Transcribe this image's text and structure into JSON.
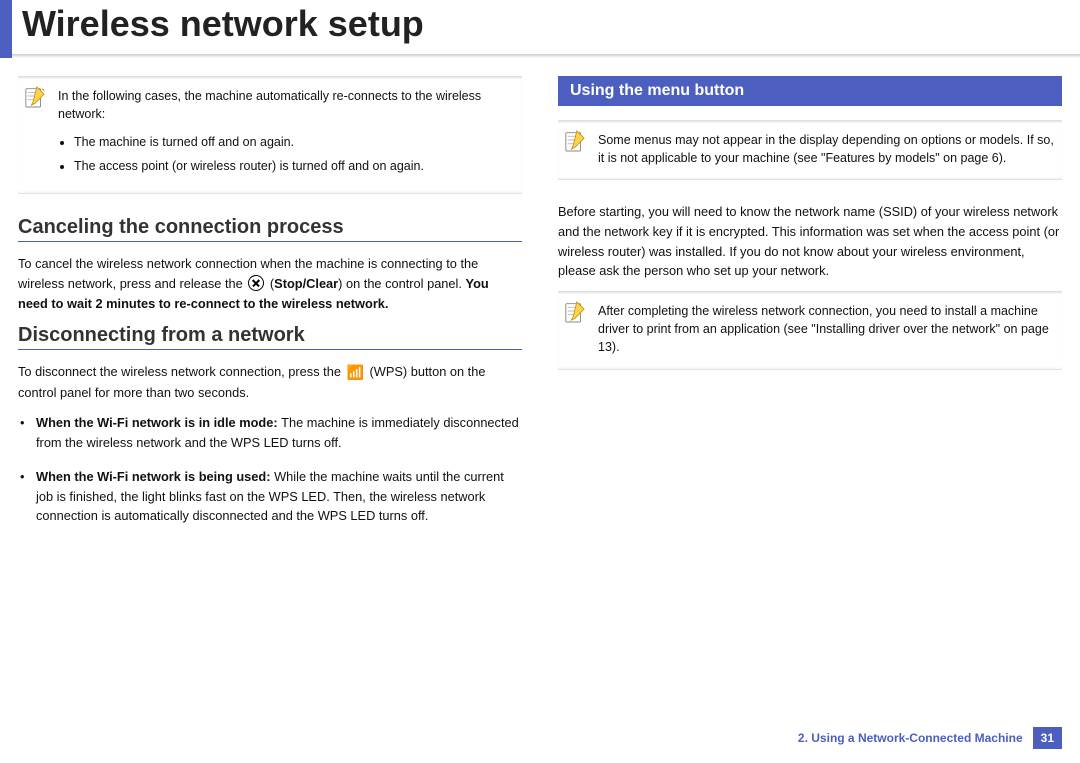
{
  "title": "Wireless network setup",
  "left": {
    "note": {
      "intro": "In the following cases, the machine automatically re-connects to the wireless network:",
      "items": [
        "The machine is turned off and on again.",
        "The access point (or wireless router) is turned off and on again."
      ]
    },
    "cancel": {
      "heading": "Canceling the connection process",
      "p1a": "To cancel the wireless network connection when the machine is connecting to the wireless network, press and release the ",
      "p1b": " (",
      "stopclear": "Stop/Clear",
      "p1c": ") on the control panel. ",
      "bold_tail": "You need to wait 2 minutes to re-connect to the wireless network."
    },
    "disc": {
      "heading": "Disconnecting from a network",
      "p1a": "To disconnect the wireless network connection, press the ",
      "p1b": " (WPS) button on the control panel for more than two seconds.",
      "items": [
        {
          "bold": "When the Wi-Fi network is in idle mode: ",
          "rest": "The machine is immediately disconnected from the wireless network and the WPS LED turns off."
        },
        {
          "bold": "When the Wi-Fi network is being used: ",
          "rest": "While the machine waits until the current job is finished, the light blinks fast on the WPS LED. Then, the wireless network connection is automatically disconnected and the WPS LED turns off."
        }
      ]
    }
  },
  "right": {
    "banner": "Using the menu button",
    "note1": "Some menus may not appear in the display depending on options or models. If so, it is not applicable to your machine (see \"Features by models\" on page 6).",
    "para": "Before starting, you will need to know the network name (SSID) of your wireless network and the network key if it is encrypted. This information was set when the access point (or wireless router) was installed. If you do not know about your wireless environment, please ask the person who set up your network.",
    "note2": "After completing the wireless network connection, you need to install a machine driver to print from an application (see \"Installing driver over the network\" on page 13)."
  },
  "footer": {
    "chapter": "2.  Using a Network-Connected Machine",
    "page": "31"
  }
}
